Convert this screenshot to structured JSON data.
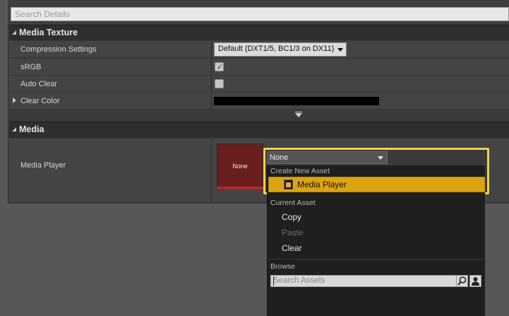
{
  "search": {
    "placeholder": "Search Details"
  },
  "media_texture": {
    "title": "Media Texture",
    "compression_settings": {
      "label": "Compression Settings",
      "value": "Default (DXT1/5, BC1/3 on DX11)"
    },
    "srgb": {
      "label": "sRGB",
      "checked": true
    },
    "auto_clear": {
      "label": "Auto Clear",
      "checked": false
    },
    "clear_color": {
      "label": "Clear Color",
      "color": "#000000"
    }
  },
  "media": {
    "title": "Media",
    "media_player": {
      "label": "Media Player",
      "thumbnail_text": "None",
      "selected": "None"
    }
  },
  "asset_menu": {
    "create_new_heading": "Create New Asset",
    "create_item": "Media Player",
    "current_heading": "Current Asset",
    "copy": "Copy",
    "paste": "Paste",
    "clear": "Clear",
    "browse_heading": "Browse",
    "search_placeholder": "Search Assets"
  },
  "colors": {
    "highlight": "#dca410",
    "focus_border": "#f0d24a",
    "thumbnail_bg": "#6a1f1f",
    "thumbnail_bar": "#d22020"
  }
}
